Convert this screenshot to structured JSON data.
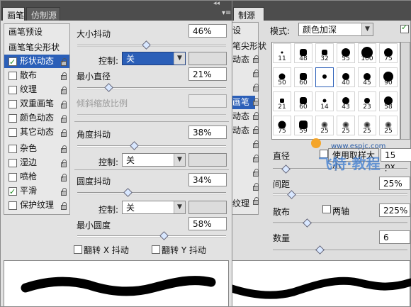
{
  "front_panel": {
    "tabs": [
      "画笔",
      "仿制源"
    ],
    "menu_arrow": "▾≡",
    "collapse_arrows": "◂◂",
    "sidebar_items": [
      {
        "label": "画笔预设",
        "checkbox": false,
        "checked": false,
        "lock": false
      },
      {
        "label": "画笔笔尖形状",
        "checkbox": false,
        "checked": false,
        "lock": false
      },
      {
        "label": "形状动态",
        "checkbox": true,
        "checked": true,
        "lock": true,
        "selected": true
      },
      {
        "label": "散布",
        "checkbox": true,
        "checked": false,
        "lock": true
      },
      {
        "label": "纹理",
        "checkbox": true,
        "checked": false,
        "lock": true
      },
      {
        "label": "双重画笔",
        "checkbox": true,
        "checked": false,
        "lock": true
      },
      {
        "label": "颜色动态",
        "checkbox": true,
        "checked": false,
        "lock": true
      },
      {
        "label": "其它动态",
        "checkbox": true,
        "checked": false,
        "lock": true
      },
      {
        "label": "杂色",
        "checkbox": true,
        "checked": false,
        "lock": true
      },
      {
        "label": "湿边",
        "checkbox": true,
        "checked": false,
        "lock": true
      },
      {
        "label": "喷枪",
        "checkbox": true,
        "checked": false,
        "lock": true
      },
      {
        "label": "平滑",
        "checkbox": true,
        "checked": true,
        "lock": true
      },
      {
        "label": "保护纹理",
        "checkbox": true,
        "checked": false,
        "lock": true
      }
    ],
    "size_jitter": {
      "label": "大小抖动",
      "value": "46%",
      "slider": 0.46
    },
    "size_control": {
      "label": "控制:",
      "value": "关"
    },
    "min_diameter": {
      "label": "最小直径",
      "value": "21%",
      "slider": 0.21
    },
    "tilt_scale": {
      "label": "倾斜缩放比例",
      "value": ""
    },
    "angle_jitter": {
      "label": "角度抖动",
      "value": "38%",
      "slider": 0.38
    },
    "angle_control": {
      "label": "控制:",
      "value": "关"
    },
    "roundness_jitter": {
      "label": "圆度抖动",
      "value": "34%",
      "slider": 0.34
    },
    "roundness_control": {
      "label": "控制:",
      "value": "关"
    },
    "min_roundness": {
      "label": "最小圆度",
      "value": "58%",
      "slider": 0.58
    },
    "flip_x": "翻转 X 抖动",
    "flip_y": "翻转 Y 抖动"
  },
  "back_panel": {
    "tab": "制源",
    "sidebar_partial": [
      "设",
      "笔尖形状",
      "动态",
      "",
      "",
      "画笔",
      "动态",
      "动态",
      "",
      "",
      "",
      "",
      "纹理"
    ],
    "mode_label": "模式:",
    "mode_value": "颜色加深",
    "brush_sizes": [
      "11",
      "48",
      "32",
      "55",
      "100",
      "75",
      "50",
      "60",
      "20",
      "40",
      "45",
      "90",
      "21",
      "60",
      "14",
      "43",
      "23",
      "58",
      "75",
      "59",
      "25",
      "25",
      "25",
      "25"
    ],
    "diameter": {
      "label": "直径",
      "checkbox_label": "使用取样大小",
      "value": "15 px"
    },
    "spacing": {
      "label": "间距",
      "value": "25%"
    },
    "scatter": {
      "label": "散布",
      "both_axes": "两轴",
      "value": "225%"
    },
    "count": {
      "label": "数量",
      "value": "6"
    }
  },
  "watermark": {
    "url": "www.espjc.com",
    "brand": "飞特·教程"
  },
  "colors": {
    "selection": "#2b5fb8",
    "panel": "#e2e2e2",
    "tabbar": "#4d4d4d"
  }
}
